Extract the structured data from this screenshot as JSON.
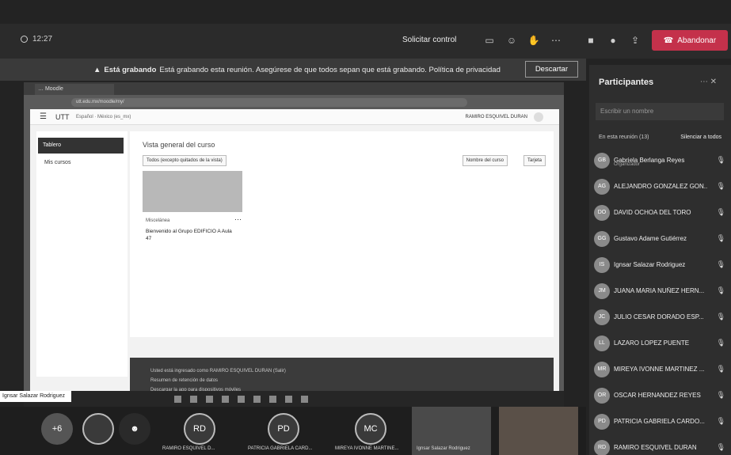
{
  "topbar": {
    "time": "12:27",
    "request_control": "Solicitar control",
    "leave": "Abandonar"
  },
  "banner": {
    "lead": "Está grabando",
    "message": "Está grabando esta reunión. Asegúrese de que todos sepan que está grabando. Política de privacidad",
    "dismiss": "Descartar"
  },
  "browser": {
    "tab": "… Moodle",
    "url": "utt.edu.mx/moodle/my/"
  },
  "moodle": {
    "brand": "UTT",
    "lang": "Español · México (es_mx)",
    "user": "RAMIRO ESQUIVEL DURAN",
    "sidebar_active": "Tablero",
    "sidebar_courses": "Mis cursos",
    "overview_title": "Vista general del curso",
    "filter": "Todos (excepto quitados de la vista)",
    "sort": "Nombre del curso",
    "view": "Tarjeta",
    "course_category": "Miscelánea",
    "course_name": "Bienvenido al Grupo EDIFICIO A Aula 47",
    "footer_logged": "Usted está ingresado como RAMIRO ESQUIVEL DURAN (Salir)",
    "footer_policy": "Resumen de retención de datos",
    "footer_app": "Descargar la app para dispositivos móviles"
  },
  "participants": {
    "title": "Participantes",
    "search_placeholder": "Escribir un nombre",
    "in_meeting": "En esta reunión (13)",
    "mute_all": "Silenciar a todos",
    "people": [
      {
        "initials": "GB",
        "name": "Gabriela Berlanga Reyes",
        "role": "Organizador"
      },
      {
        "initials": "AG",
        "name": "ALEJANDRO GONZALEZ GON..."
      },
      {
        "initials": "DO",
        "name": "DAVID OCHOA DEL TORO"
      },
      {
        "initials": "GG",
        "name": "Gustavo Adame Gutiérrez"
      },
      {
        "initials": "IS",
        "name": "Ignsar Salazar Rodriguez"
      },
      {
        "initials": "JM",
        "name": "JUANA MARIA NUÑEZ HERN..."
      },
      {
        "initials": "JC",
        "name": "JULIO CESAR DORADO ESP..."
      },
      {
        "initials": "LL",
        "name": "LAZARO LOPEZ PUENTE"
      },
      {
        "initials": "MR",
        "name": "MIREYA IVONNE MARTINEZ ..."
      },
      {
        "initials": "OR",
        "name": "OSCAR HERNANDEZ REYES"
      },
      {
        "initials": "PD",
        "name": "PATRICIA GABRIELA CARDO..."
      },
      {
        "initials": "RD",
        "name": "RAMIRO ESQUIVEL DURAN"
      }
    ]
  },
  "strip": {
    "speaker_label": "Ignsar Salazar Rodriguez",
    "plus": "+6",
    "tiles": [
      {
        "initials": "RD",
        "name": "RAMIRO ESQUIVEL D..."
      },
      {
        "initials": "PD",
        "name": "PATRICIA GABRIELA CARD..."
      },
      {
        "initials": "MC",
        "name": "MIREYA IVONNE MARTINE..."
      }
    ],
    "video1_name": "Ignsar Salazar Rodriguez"
  }
}
